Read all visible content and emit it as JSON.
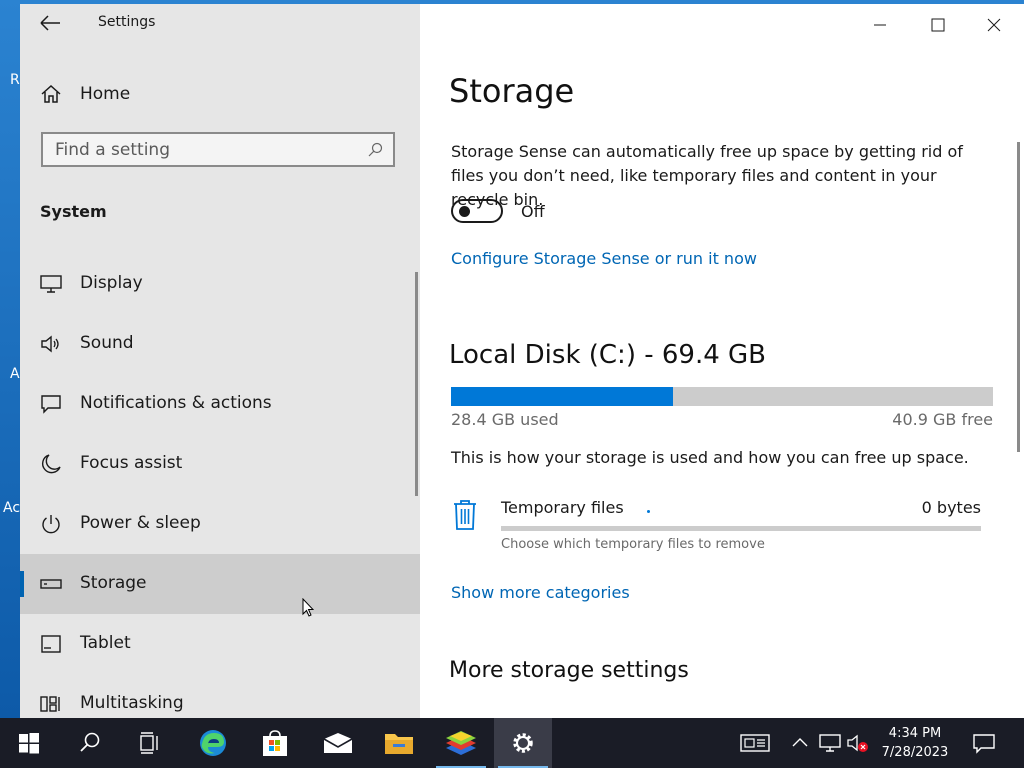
{
  "desktop": {
    "letters": [
      "R",
      "A",
      "Ac"
    ]
  },
  "window": {
    "title": "Settings",
    "controls": {
      "minimize": "minimize-icon",
      "maximize": "maximize-icon",
      "close": "close-icon"
    }
  },
  "sidebar": {
    "home_label": "Home",
    "search_placeholder": "Find a setting",
    "section_title": "System",
    "items": [
      {
        "label": "Display",
        "icon": "display-icon"
      },
      {
        "label": "Sound",
        "icon": "speaker-icon"
      },
      {
        "label": "Notifications & actions",
        "icon": "notification-icon"
      },
      {
        "label": "Focus assist",
        "icon": "moon-icon"
      },
      {
        "label": "Power & sleep",
        "icon": "power-icon"
      },
      {
        "label": "Storage",
        "icon": "storage-icon",
        "active": true
      },
      {
        "label": "Tablet",
        "icon": "tablet-icon"
      },
      {
        "label": "Multitasking",
        "icon": "multitasking-icon"
      }
    ]
  },
  "main": {
    "title": "Storage",
    "description": "Storage Sense can automatically free up space by getting rid of files you don’t need, like temporary files and content in your recycle bin.",
    "toggle_state": "Off",
    "configure_link": "Configure Storage Sense or run it now",
    "disk": {
      "title": "Local Disk (C:) - 69.4 GB",
      "used_label": "28.4 GB used",
      "free_label": "40.9 GB free",
      "used_fraction": 0.41
    },
    "explain": "This is how your storage is used and how you can free up space.",
    "category": {
      "name": "Temporary files",
      "size": "0 bytes",
      "sub": "Choose which temporary files to remove",
      "icon": "trash-icon"
    },
    "show_more_link": "Show more categories",
    "more_settings_title": "More storage settings"
  },
  "taskbar": {
    "time": "4:34 PM",
    "date": "7/28/2023",
    "colors": {
      "background": "#1a1c26",
      "accent": "#0078d7"
    }
  }
}
